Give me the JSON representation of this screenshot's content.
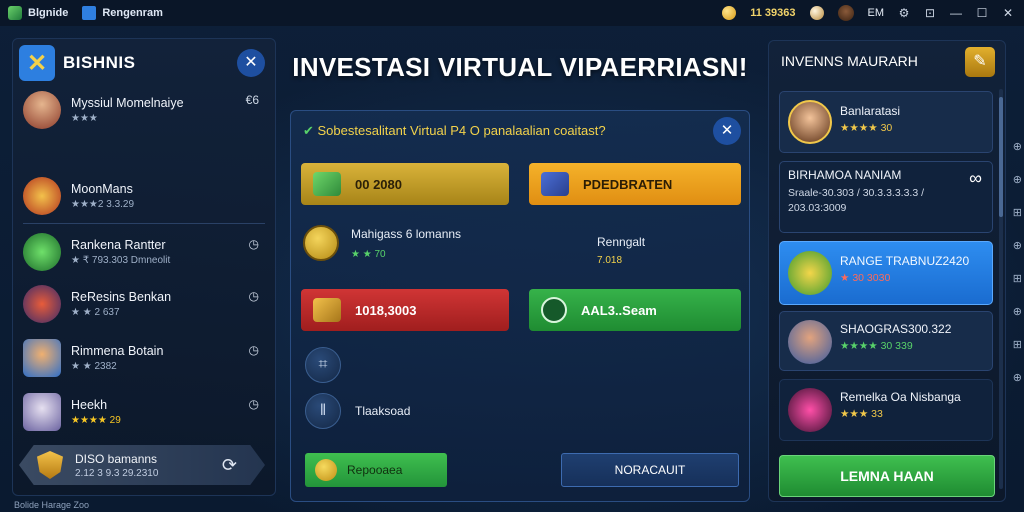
{
  "topbar": {
    "app_name": "Blgnide",
    "tab_title": "Rengenram",
    "coins": "11 39363",
    "user_initials": "EM"
  },
  "left_panel": {
    "title": "BISHNIS",
    "items": [
      {
        "name": "Myssiul Momelnaiye",
        "sub": "★★★",
        "action": "€6"
      },
      {
        "name": "MoonMans",
        "sub": "★★★2 3.3.29",
        "action": ""
      },
      {
        "name": "Rankena Rantter",
        "sub": "★ ₹ 793.303 Dmneolit",
        "action": "◷"
      },
      {
        "name": "ReResins Benkan",
        "sub": "★ ★ 2 637",
        "action": "◷"
      },
      {
        "name": "Rimmena Botain",
        "sub": "★ ★ 2382",
        "action": "◷"
      },
      {
        "name": "Heekh",
        "sub": "★★★★ 29",
        "action": "◷"
      }
    ],
    "footer_title": "DISO bamanns",
    "footer_sub": "2.12 3 9.3 29.2310",
    "status": "Bolide Harage Zoo"
  },
  "center": {
    "title": "INVESTASI VIRTUAL VIPAERRIASN!",
    "subtitle": "Sobestesalitant Virtual P4 O panalaalian coaitast?",
    "tile_gold": "00 2080",
    "tile_orange": "PDEDBRATEN",
    "info_left_title": "Mahigass 6 lomanns",
    "info_left_sub": "★ ★ 70",
    "info_right_title": "Renngalt",
    "info_right_sub": "7.018",
    "tile_red": "1018,3003",
    "tile_green": "AAL3..Seam",
    "row_label": "Tlaaksoad",
    "btn_green": "Repooaea",
    "btn_blue": "NORACAUIT"
  },
  "right_panel": {
    "title": "INVENNS MAURARH",
    "cards": [
      {
        "name": "Banlaratasi",
        "sub": "★★★★ 30"
      },
      {
        "name": "BIRHAMOA NANIAM",
        "sub": "Sraale-30.303 / 30.3.3.3.3.3 / 203.03:3009"
      },
      {
        "name": "RANGE TRABNUZ2420",
        "sub": "★ 30 3030"
      },
      {
        "name": "SHAOGRAS300.322",
        "sub": "★★★★ 30 339"
      },
      {
        "name": "Remelka Oa Nisbanga",
        "sub": "★★★ 33"
      }
    ],
    "cta": "LEMNA HAAN"
  }
}
